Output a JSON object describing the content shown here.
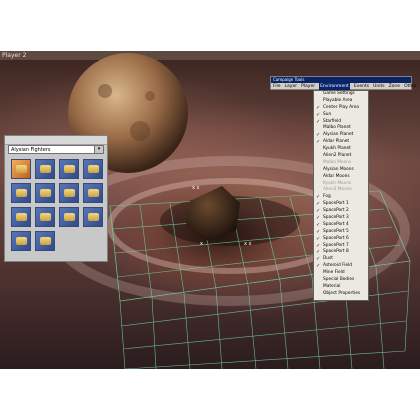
{
  "window": {
    "title": "Player 2"
  },
  "fighters_panel": {
    "title": "",
    "dropdown_value": "Alysian Fighters",
    "dropdown_arrow": "▾",
    "tiles": [
      "fighter-1",
      "fighter-2",
      "fighter-3",
      "fighter-4",
      "fighter-5",
      "fighter-6",
      "fighter-7",
      "fighter-8",
      "fighter-9",
      "fighter-10",
      "fighter-11",
      "fighter-12",
      "fighter-13",
      "fighter-14"
    ]
  },
  "campaign_tools": {
    "title": "Campaign Tools",
    "menus": [
      "File",
      "Layer",
      "Player",
      "Environment",
      "Events",
      "Units",
      "Zone",
      "Other"
    ],
    "active_menu": "Environment",
    "items": [
      {
        "label": "Game Settings",
        "checked": false,
        "disabled": false
      },
      {
        "label": "Playable Area",
        "checked": false,
        "disabled": false
      },
      {
        "label": "Center Play Area",
        "checked": true,
        "disabled": false
      },
      {
        "label": "Sun",
        "checked": true,
        "disabled": false
      },
      {
        "label": "Starfield",
        "checked": true,
        "disabled": false
      },
      {
        "label": "Malbo Planet",
        "checked": false,
        "disabled": false
      },
      {
        "label": "Alysian Planet",
        "checked": true,
        "disabled": false
      },
      {
        "label": "Aldar Planet",
        "checked": true,
        "disabled": false
      },
      {
        "label": "Kyukh Planet",
        "checked": false,
        "disabled": false
      },
      {
        "label": "Alien2 Planet",
        "checked": false,
        "disabled": false
      },
      {
        "label": "Malbo Moons",
        "checked": false,
        "disabled": true
      },
      {
        "label": "Alysian Moons",
        "checked": false,
        "disabled": false
      },
      {
        "label": "Aldar Moons",
        "checked": false,
        "disabled": false
      },
      {
        "label": "Kyukh Moons",
        "checked": false,
        "disabled": true
      },
      {
        "label": "Alien2 Moons",
        "checked": false,
        "disabled": true
      },
      {
        "label": "Fog",
        "checked": true,
        "disabled": false
      },
      {
        "label": "SpacePort 1",
        "checked": true,
        "disabled": false
      },
      {
        "label": "SpacePort 2",
        "checked": true,
        "disabled": false
      },
      {
        "label": "SpacePort 3",
        "checked": true,
        "disabled": false
      },
      {
        "label": "SpacePort 4",
        "checked": true,
        "disabled": false
      },
      {
        "label": "SpacePort 5",
        "checked": true,
        "disabled": false
      },
      {
        "label": "SpacePort 6",
        "checked": true,
        "disabled": false
      },
      {
        "label": "SpacePort 7",
        "checked": true,
        "disabled": false
      },
      {
        "label": "SpacePort 8",
        "checked": true,
        "disabled": false
      },
      {
        "label": "Dust",
        "checked": true,
        "disabled": false
      },
      {
        "label": "Asteroid Field",
        "checked": true,
        "disabled": false
      },
      {
        "label": "Mine Field",
        "checked": false,
        "disabled": false
      },
      {
        "label": "Special Bodies",
        "checked": false,
        "disabled": false
      },
      {
        "label": "Material",
        "checked": false,
        "disabled": false
      },
      {
        "label": "Object Properties",
        "checked": false,
        "disabled": false
      }
    ]
  },
  "colors": {
    "menu_highlight": "#0a246a",
    "grid_line": "#6fd6a0",
    "tile_bg": "#3a5aa0"
  }
}
